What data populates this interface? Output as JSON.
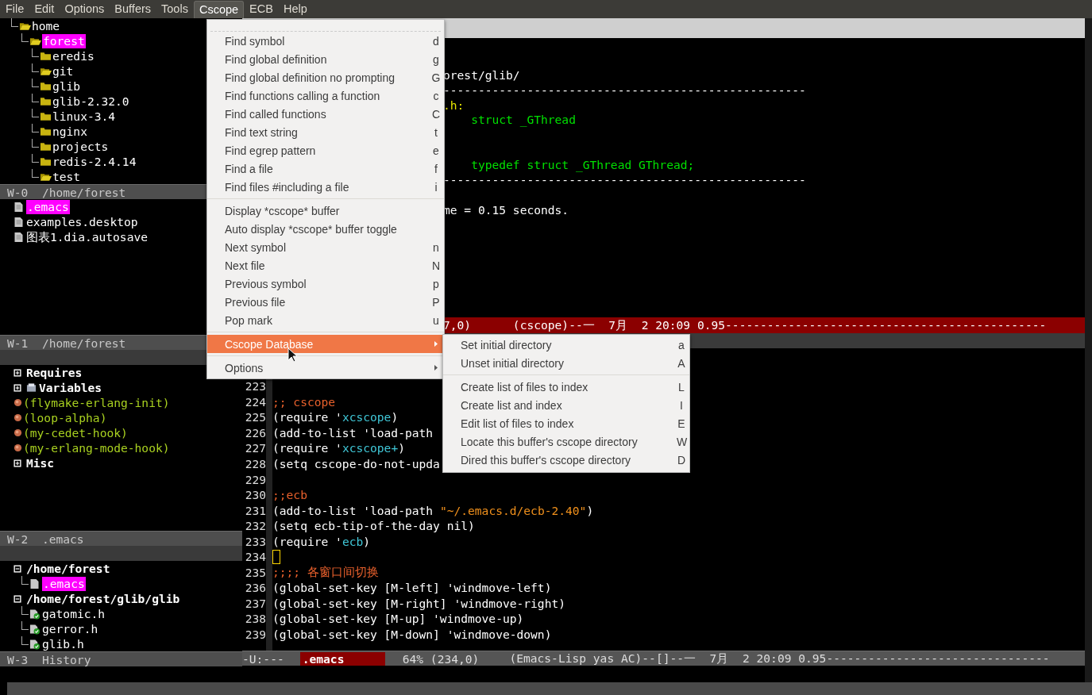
{
  "menubar": [
    {
      "label": "File",
      "selected": false
    },
    {
      "label": "Edit",
      "selected": false
    },
    {
      "label": "Options",
      "selected": false
    },
    {
      "label": "Buffers",
      "selected": false
    },
    {
      "label": "Tools",
      "selected": false
    },
    {
      "label": "Cscope",
      "selected": true
    },
    {
      "label": "ECB",
      "selected": false
    },
    {
      "label": "Help",
      "selected": false
    }
  ],
  "ecb": {
    "directories": [
      {
        "label": "home",
        "kind": "folder-open",
        "selected": false,
        "children": [
          {
            "label": "forest",
            "kind": "folder-open",
            "selected": true,
            "children": [
              {
                "label": "eredis",
                "kind": "folder",
                "selected": false
              },
              {
                "label": "git",
                "kind": "folder-open",
                "selected": false
              },
              {
                "label": "glib",
                "kind": "folder",
                "selected": false
              },
              {
                "label": "glib-2.32.0",
                "kind": "folder",
                "selected": false
              },
              {
                "label": "linux-3.4",
                "kind": "folder",
                "selected": false
              },
              {
                "label": "nginx",
                "kind": "folder",
                "selected": false
              },
              {
                "label": "projects",
                "kind": "folder",
                "selected": false
              },
              {
                "label": "redis-2.4.14",
                "kind": "folder",
                "selected": false
              },
              {
                "label": "test",
                "kind": "folder-open",
                "selected": false
              }
            ]
          }
        ]
      }
    ],
    "directories_mode_line": "W-0  /home/forest",
    "sources": [
      {
        "label": ".emacs",
        "selected": true
      },
      {
        "label": "examples.desktop",
        "selected": false
      },
      {
        "label": "图表1.dia.autosave",
        "selected": false
      }
    ],
    "sources_mode_line": "W-1  /home/forest",
    "methods": [
      {
        "label": "Requires",
        "kind": "group"
      },
      {
        "label": "Variables",
        "kind": "variables"
      },
      {
        "label": "(flymake-erlang-init)",
        "kind": "function"
      },
      {
        "label": "(loop-alpha)",
        "kind": "function"
      },
      {
        "label": "(my-cedet-hook)",
        "kind": "function"
      },
      {
        "label": "(my-erlang-mode-hook)",
        "kind": "function"
      },
      {
        "label": "Misc",
        "kind": "group"
      }
    ],
    "methods_mode_line": "W-2  .emacs",
    "history": [
      {
        "label": "/home/forest",
        "kind": "dir",
        "selected": false,
        "children": [
          {
            "label": ".emacs",
            "kind": "file",
            "selected": true
          }
        ]
      },
      {
        "label": "/home/forest/glib/glib",
        "kind": "dir",
        "selected": false,
        "children": [
          {
            "label": "gatomic.h",
            "kind": "header",
            "selected": false
          },
          {
            "label": "gerror.h",
            "kind": "header",
            "selected": false
          },
          {
            "label": "glib.h",
            "kind": "header",
            "selected": false
          }
        ]
      }
    ],
    "history_mode_line": "W-3  History"
  },
  "cscope_window": {
    "lines": [
      {
        "kind": "blank"
      },
      {
        "kind": "blank"
      },
      {
        "kind": "text",
        "segments": [
          {
            "text": "orest/glib/",
            "kind": "plain"
          }
        ]
      },
      {
        "kind": "text",
        "segments": [
          {
            "text": "----------------------------------------------------",
            "kind": "plain"
          }
        ]
      },
      {
        "kind": "text",
        "segments": [
          {
            "text": ".h:",
            "kind": "file"
          }
        ]
      },
      {
        "kind": "text",
        "segments": [
          {
            "text": "    struct _GThread",
            "kind": "match"
          }
        ]
      },
      {
        "kind": "blank"
      },
      {
        "kind": "blank"
      },
      {
        "kind": "text",
        "segments": [
          {
            "text": "    typedef struct _GThread GThread;",
            "kind": "match"
          }
        ]
      },
      {
        "kind": "text",
        "segments": [
          {
            "text": "----------------------------------------------------",
            "kind": "plain"
          }
        ]
      },
      {
        "kind": "blank"
      },
      {
        "kind": "text",
        "segments": [
          {
            "text": "me = 0.15 seconds.",
            "kind": "plain"
          }
        ]
      }
    ],
    "mode_line": "7,0)      (cscope)--一  7月  2 20:09 0.95----------------------------------------------"
  },
  "editor": {
    "lines": [
      {
        "number": "223",
        "cursor": false
      },
      {
        "number": "224",
        "cursor": false,
        "segments": [
          {
            "text": ";; cscope",
            "kind": "comment"
          }
        ]
      },
      {
        "number": "225",
        "cursor": false,
        "segments": [
          {
            "text": "(require '",
            "kind": "plain"
          },
          {
            "text": "xcscope",
            "kind": "symbol"
          },
          {
            "text": ")",
            "kind": "plain"
          }
        ]
      },
      {
        "number": "226",
        "cursor": false,
        "segments": [
          {
            "text": "(add-to-list 'load-path",
            "kind": "plain"
          }
        ]
      },
      {
        "number": "227",
        "cursor": false,
        "segments": [
          {
            "text": "(require '",
            "kind": "plain"
          },
          {
            "text": "xcscope+",
            "kind": "symbol"
          },
          {
            "text": ")",
            "kind": "plain"
          }
        ]
      },
      {
        "number": "228",
        "cursor": false,
        "segments": [
          {
            "text": "(setq cscope-do-not-upda",
            "kind": "plain"
          }
        ]
      },
      {
        "number": "229",
        "cursor": false
      },
      {
        "number": "230",
        "cursor": false,
        "segments": [
          {
            "text": ";;ecb",
            "kind": "comment"
          }
        ]
      },
      {
        "number": "231",
        "cursor": false,
        "segments": [
          {
            "text": "(add-to-list 'load-path ",
            "kind": "plain"
          },
          {
            "text": "\"~/.emacs.d/ecb-2.40\"",
            "kind": "string"
          },
          {
            "text": ")",
            "kind": "plain"
          }
        ]
      },
      {
        "number": "232",
        "cursor": false,
        "segments": [
          {
            "text": "(setq ecb-tip-of-the-day nil)",
            "kind": "plain"
          }
        ]
      },
      {
        "number": "233",
        "cursor": false,
        "segments": [
          {
            "text": "(require '",
            "kind": "plain"
          },
          {
            "text": "ecb",
            "kind": "symbol"
          },
          {
            "text": ")",
            "kind": "plain"
          }
        ]
      },
      {
        "number": "234",
        "cursor": true
      },
      {
        "number": "235",
        "cursor": false,
        "segments": [
          {
            "text": ";;;; 各窗口间切换",
            "kind": "comment"
          }
        ]
      },
      {
        "number": "236",
        "cursor": false,
        "segments": [
          {
            "text": "(global-set-key [M-left] 'windmove-left)",
            "kind": "plain"
          }
        ]
      },
      {
        "number": "237",
        "cursor": false,
        "segments": [
          {
            "text": "(global-set-key [M-right] 'windmove-right)",
            "kind": "plain"
          }
        ]
      },
      {
        "number": "238",
        "cursor": false,
        "segments": [
          {
            "text": "(global-set-key [M-up] 'windmove-up)",
            "kind": "plain"
          }
        ]
      },
      {
        "number": "239",
        "cursor": false,
        "segments": [
          {
            "text": "(global-set-key [M-down] 'windmove-down)",
            "kind": "plain"
          }
        ]
      }
    ],
    "mode_line": {
      "status": "-U:---",
      "buffer": ".emacs",
      "position": "64% (234,0)",
      "modes": "(Emacs-Lisp yas AC)--[]--一  7月  2 20:09 0.95--------------------------------"
    }
  },
  "cscope_menu": [
    {
      "kind": "item",
      "label": "Find symbol",
      "key": "d",
      "selected": false
    },
    {
      "kind": "item",
      "label": "Find global definition",
      "key": "g",
      "selected": false
    },
    {
      "kind": "item",
      "label": "Find global definition no prompting",
      "key": "G",
      "selected": false
    },
    {
      "kind": "item",
      "label": "Find functions calling a function",
      "key": "c",
      "selected": false
    },
    {
      "kind": "item",
      "label": "Find called functions",
      "key": "C",
      "selected": false
    },
    {
      "kind": "item",
      "label": "Find text string",
      "key": "t",
      "selected": false
    },
    {
      "kind": "item",
      "label": "Find egrep pattern",
      "key": "e",
      "selected": false
    },
    {
      "kind": "item",
      "label": "Find a file",
      "key": "f",
      "selected": false
    },
    {
      "kind": "item",
      "label": "Find files #including a file",
      "key": "i",
      "selected": false
    },
    {
      "kind": "separator"
    },
    {
      "kind": "item",
      "label": "Display *cscope* buffer",
      "selected": false
    },
    {
      "kind": "item",
      "label": "Auto display *cscope* buffer toggle",
      "selected": false
    },
    {
      "kind": "item",
      "label": "Next symbol",
      "key": "n",
      "selected": false
    },
    {
      "kind": "item",
      "label": "Next file",
      "key": "N",
      "selected": false
    },
    {
      "kind": "item",
      "label": "Previous symbol",
      "key": "p",
      "selected": false
    },
    {
      "kind": "item",
      "label": "Previous file",
      "key": "P",
      "selected": false
    },
    {
      "kind": "item",
      "label": "Pop mark",
      "key": "u",
      "selected": false
    },
    {
      "kind": "separator"
    },
    {
      "kind": "submenu",
      "label": "Cscope Database",
      "selected": true
    },
    {
      "kind": "separator"
    },
    {
      "kind": "submenu",
      "label": "Options",
      "selected": false
    }
  ],
  "database_submenu": [
    {
      "kind": "item",
      "label": "Set initial directory",
      "key": "a",
      "selected": false
    },
    {
      "kind": "item",
      "label": "Unset initial directory",
      "key": "A",
      "selected": false
    },
    {
      "kind": "separator"
    },
    {
      "kind": "item",
      "label": "Create list of files to index",
      "key": "L",
      "selected": false
    },
    {
      "kind": "item",
      "label": "Create list and index",
      "key": "I",
      "selected": false
    },
    {
      "kind": "item",
      "label": "Edit list of files to index",
      "key": "E",
      "selected": false
    },
    {
      "kind": "item",
      "label": "Locate this buffer's cscope directory",
      "key": "W",
      "selected": false
    },
    {
      "kind": "item",
      "label": "Dired this buffer's cscope directory",
      "key": "D",
      "selected": false
    }
  ]
}
